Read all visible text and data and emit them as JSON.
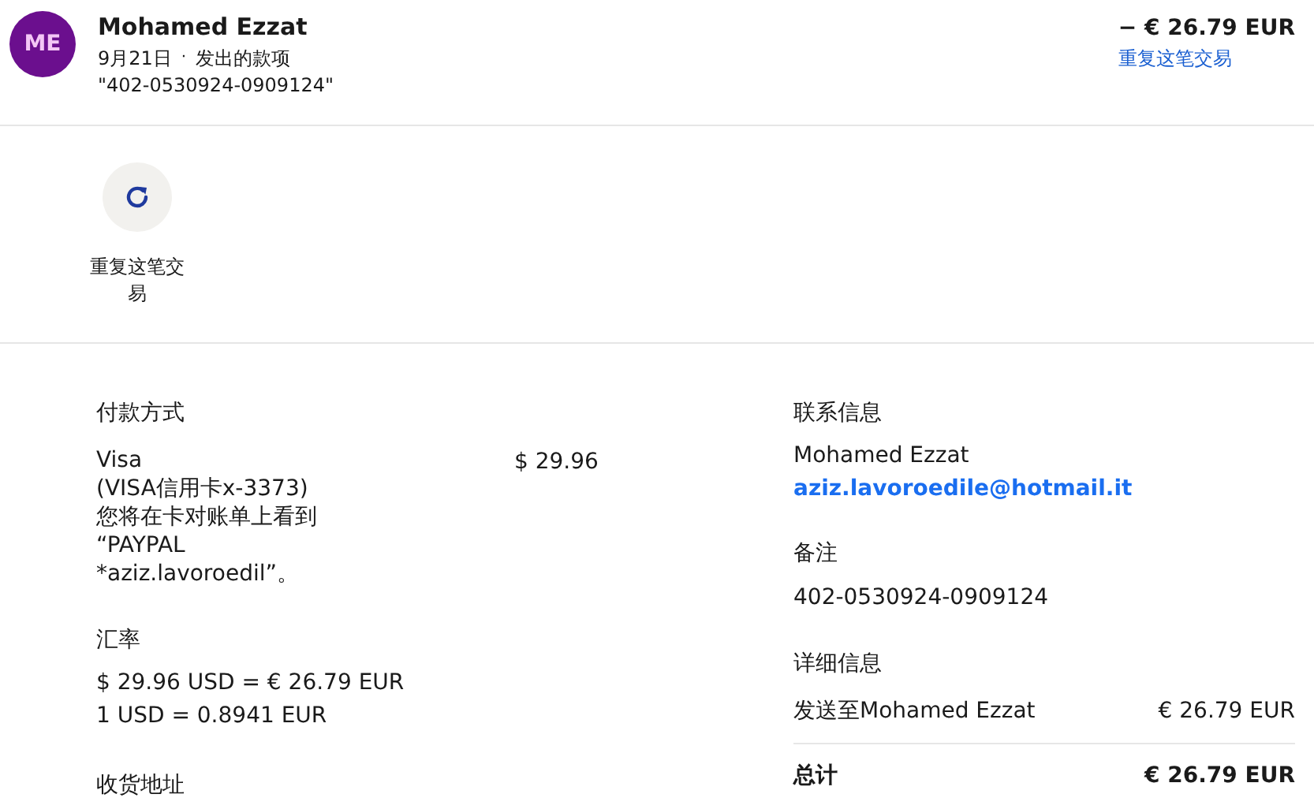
{
  "header": {
    "avatar": "ME",
    "name": "Mohamed Ezzat",
    "date": "9月21日",
    "separator": "·",
    "type": "发出的款项",
    "reference": "\"402-0530924-0909124\"",
    "amount": "− € 26.79 EUR",
    "repeat_link": "重复这笔交易"
  },
  "actions": [
    {
      "label": "重复这笔交易"
    }
  ],
  "payment": {
    "heading": "付款方式",
    "lines": [
      "Visa",
      "(VISA信用卡x-3373)",
      "您将在卡对账单上看到",
      "“PAYPAL",
      "*aziz.lavoroedil”。"
    ],
    "amount": "$ 29.96"
  },
  "exchange": {
    "heading": "汇率",
    "lines": [
      "$ 29.96 USD = € 26.79 EUR",
      "1 USD = 0.8941 EUR"
    ]
  },
  "shipping": {
    "heading": "收货地址"
  },
  "contact": {
    "heading": "联系信息",
    "name": "Mohamed Ezzat",
    "email": "aziz.lavoroedile@hotmail.it"
  },
  "note": {
    "heading": "备注",
    "text": "402-0530924-0909124"
  },
  "details": {
    "heading": "详细信息",
    "rows": [
      {
        "label": "发送至Mohamed Ezzat",
        "amount": "€ 26.79 EUR",
        "kind": "item"
      },
      {
        "label": "总计",
        "amount": "€ 26.79 EUR",
        "kind": "total"
      }
    ]
  }
}
